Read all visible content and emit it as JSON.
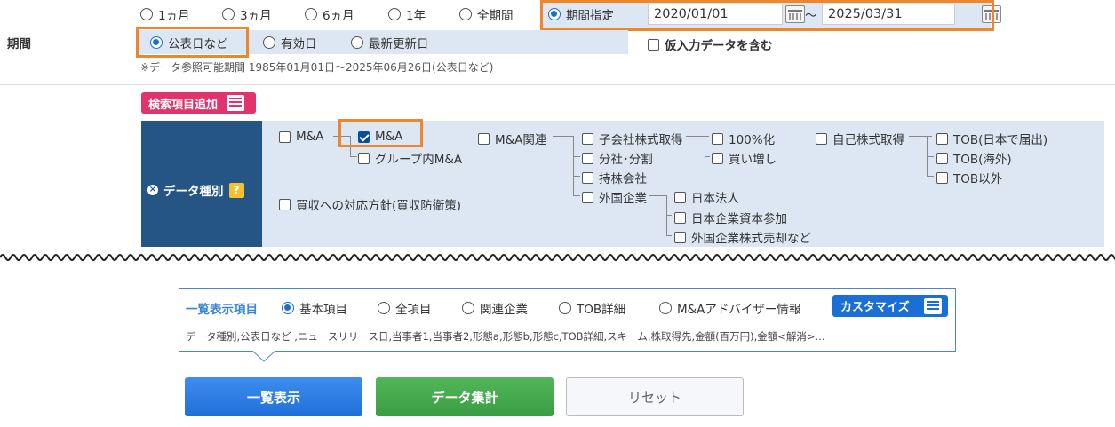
{
  "period": {
    "label": "期間",
    "radios": [
      "1ヵ月",
      "3ヵ月",
      "6ヵ月",
      "1年",
      "全期間"
    ],
    "custom_label": "期間指定",
    "date_from": "2020/01/01",
    "tilde": "～",
    "date_to": "2025/03/31",
    "basis": [
      "公表日など",
      "有効日",
      "最新更新日"
    ],
    "provisional_label": "仮入力データを含む",
    "note": "※データ参照可能期間 1985年01月01日～2025年06月26日(公表日など)"
  },
  "add_search_label": "検索項目追加",
  "data_type": {
    "label": "データ種別",
    "help": "?",
    "items": {
      "ma_top": "M&A",
      "ma": "M&A",
      "group_ma": "グループ内M&A",
      "ma_related": "M&A関連",
      "subsidiary": "子会社株式取得",
      "split": "分社･分割",
      "holding": "持株会社",
      "foreign": "外国企業",
      "full": "100%化",
      "additional": "買い増し",
      "buyback": "自己株式取得",
      "tob_jp": "TOB(日本で届出)",
      "tob_overseas": "TOB(海外)",
      "tob_other": "TOB以外",
      "jp_corp": "日本法人",
      "jp_capital": "日本企業資本参加",
      "foreign_sale": "外国企業株式売却など",
      "defense": "買収への対応方針(買収防衛策)"
    }
  },
  "display": {
    "label": "一覧表示項目",
    "options": [
      "基本項目",
      "全項目",
      "関連企業",
      "TOB詳細",
      "M&Aアドバイザー情報"
    ],
    "customize": "カスタマイズ",
    "columns_text": "データ種別,公表日など ,ニュースリリース日,当事者1,当事者2,形態a,形態b,形態c,TOB詳細,スキーム,株取得先,金額(百万円),金額<解消>..."
  },
  "buttons": {
    "list": "一覧表示",
    "aggregate": "データ集計",
    "reset": "リセット"
  },
  "colors": {
    "navy": "#255585",
    "light_blue": "#dde7f4",
    "orange": "#f0862b",
    "pink": "#e1336c"
  }
}
